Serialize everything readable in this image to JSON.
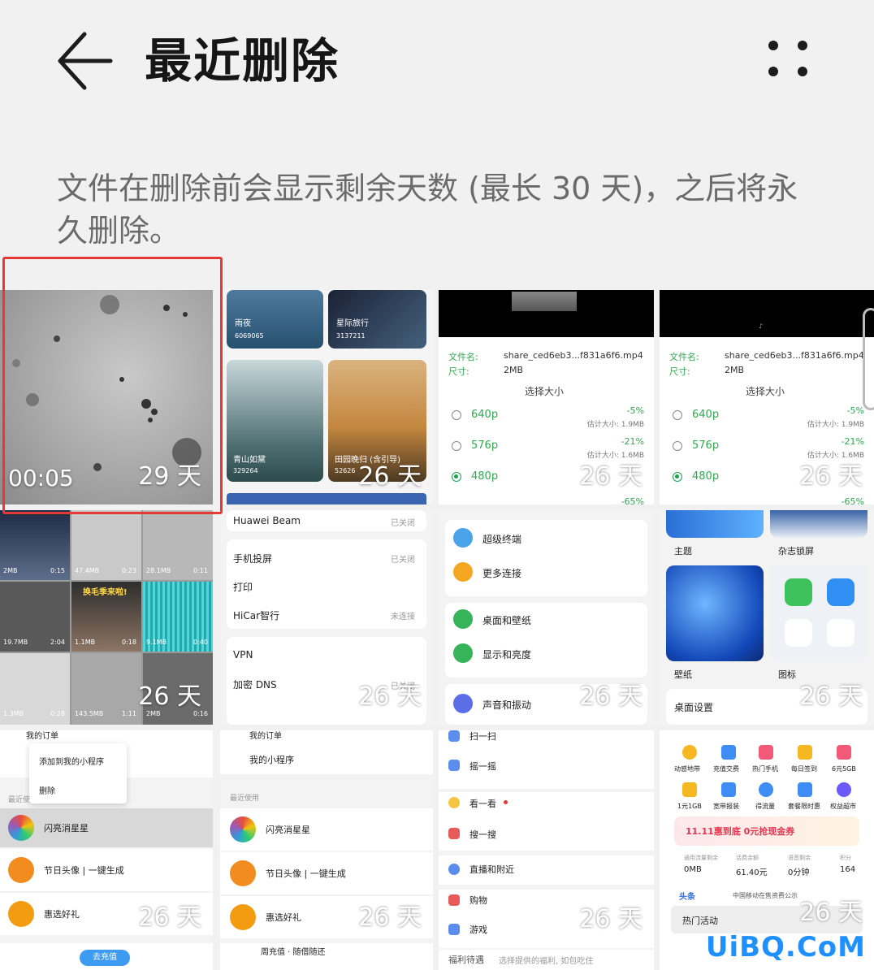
{
  "header": {
    "title": "最近删除"
  },
  "notice": "文件在删除前会显示剩余天数 (最长 30 天)，之后将永久删除。",
  "watermark": "UiBQ.CoM",
  "tiles": [
    {
      "id": "t1",
      "duration": "00:05",
      "days": "29 天"
    },
    {
      "id": "t2",
      "days": "26 天"
    },
    {
      "id": "t3",
      "days": "26 天"
    },
    {
      "id": "t4",
      "days": "26 天"
    },
    {
      "id": "t5",
      "days": "26 天"
    },
    {
      "id": "t6",
      "days": "26 天"
    },
    {
      "id": "t7",
      "days": "26 天"
    },
    {
      "id": "t8",
      "days": "26 天"
    },
    {
      "id": "t9",
      "days": "26 天"
    },
    {
      "id": "t10",
      "days": "26 天"
    },
    {
      "id": "t11",
      "days": "26 天"
    },
    {
      "id": "t12",
      "days": "26 天"
    }
  ],
  "thumbs": {
    "t2": {
      "c1": "雨夜",
      "c1_sub": "6069065",
      "c2": "星际旅行",
      "c2_sub": "3137211",
      "c3": "青山如黛",
      "c3_sub": "329264",
      "c4": "田园晚归 (含引导)",
      "c4_sub": "52626"
    },
    "t3": {
      "file_label": "文件名:",
      "file_name": "share_ced6eb3...f831a6f6.mp4",
      "size_label": "尺寸:",
      "size_value": "2MB",
      "choose": "选择大小",
      "opt1": "640p",
      "opt1_pct": "-5%",
      "opt1_est": "估计大小: 1.9MB",
      "opt2": "576p",
      "opt2_pct": "-21%",
      "opt2_est": "估计大小: 1.6MB",
      "opt3": "480p",
      "opt3_pct": "-65%"
    },
    "t4": {
      "file_label": "文件名:",
      "file_name": "share_ced6eb3...f831a6f6.mp4",
      "size_label": "尺寸:",
      "size_value": "2MB",
      "choose": "选择大小",
      "opt1": "640p",
      "opt1_pct": "-5%",
      "opt1_est": "估计大小: 1.9MB",
      "opt2": "576p",
      "opt2_pct": "-21%",
      "opt2_est": "估计大小: 1.6MB",
      "opt3": "480p",
      "opt3_pct": "-65%"
    },
    "t5": {
      "s1": "2MB",
      "s1b": "0:15",
      "s2": "47.4MB",
      "s2b": "0:23",
      "s3": "28.1MB",
      "s3b": "0:11",
      "s4": "19.7MB",
      "s4b": "2:04",
      "s5": "1.1MB",
      "s5b": "0:18",
      "s6": "9.1MB",
      "s6b": "0:40",
      "s7": "1.3MB",
      "s7b": "0:28",
      "s8": "143.5MB",
      "s8b": "1:11",
      "s9": "2MB",
      "s9b": "0:16",
      "banner": "换毛季来啦!"
    },
    "t6": {
      "r1": "Huawei Beam",
      "r1v": "已关闭",
      "r2": "手机投屏",
      "r2v": "已关闭",
      "r3": "打印",
      "r4": "HiCar智行",
      "r4v": "未连接",
      "r5": "VPN",
      "r6": "加密 DNS",
      "r6v": "已关闭"
    },
    "t7": {
      "r1": "超级终端",
      "r2": "更多连接",
      "r3": "桌面和壁纸",
      "r4": "显示和亮度",
      "r5": "声音和振动"
    },
    "t8": {
      "l1": "主题",
      "l2": "杂志锁屏",
      "l3": "壁纸",
      "l4": "图标",
      "l5": "桌面设置"
    },
    "t9": {
      "top": "我的订单",
      "menu1": "添加到我的小程序",
      "menu2": "删除",
      "recent": "最近使",
      "app1": "闪亮消星星",
      "app2": "节日头像 | 一键生成",
      "app3": "惠选好礼",
      "btn": "去充值"
    },
    "t10": {
      "top": "我的订单",
      "mine": "我的小程序",
      "recent": "最近使用",
      "app1": "闪亮消星星",
      "app2": "节日头像 | 一键生成",
      "app3": "惠选好礼",
      "bottom": "周充值 · 随借随还"
    },
    "t11": {
      "r1": "扫一扫",
      "r2": "摇一摇",
      "r3": "看一看",
      "r4": "搜一搜",
      "r5": "直播和附近",
      "r6": "购物",
      "r7": "游戏",
      "r8": "福利待遇",
      "r8v": "选择提供的福利, 如包吃住"
    },
    "t12": {
      "i1": "动感地带",
      "i2": "充值交费",
      "i3": "热门手机",
      "i4": "每日签到",
      "i5": "6元5GB",
      "i6": "1元1GB",
      "i7": "宽带报装",
      "i8": "得流量",
      "i9": "套餐限时惠",
      "i10": "权益超市",
      "promo": "11.11惠到底 0元抢现金券",
      "k1": "通用流量剩余",
      "k1v": "0MB",
      "k2": "话费余额",
      "k2v": "61.40元",
      "k3": "语音剩余",
      "k3v": "0分钟",
      "k4": "积分",
      "k4v": "164",
      "news_tag": "头条",
      "news": "中国移动在售资费公示",
      "hot": "热门活动"
    }
  },
  "colors": {
    "accent": "#17a34a",
    "selection": "#e53935",
    "watermark": "#1e90ff",
    "background": "#f1f1f1"
  }
}
